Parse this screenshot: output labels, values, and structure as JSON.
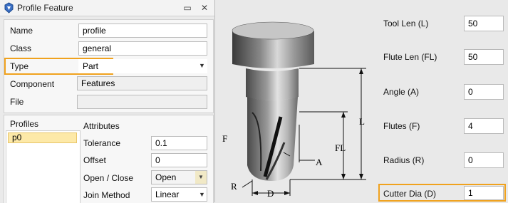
{
  "window": {
    "title": "Profile Feature"
  },
  "properties": {
    "name": {
      "label": "Name",
      "value": "profile"
    },
    "class": {
      "label": "Class",
      "value": "general"
    },
    "type": {
      "label": "Type",
      "value": "Part"
    },
    "component": {
      "label": "Component",
      "value": "Features"
    },
    "file": {
      "label": "File",
      "value": ""
    }
  },
  "profiles": {
    "header": "Profiles",
    "items": [
      "p0"
    ]
  },
  "attributes": {
    "header": "Attributes",
    "tolerance": {
      "label": "Tolerance",
      "value": "0.1"
    },
    "offset": {
      "label": "Offset",
      "value": "0"
    },
    "open_close": {
      "label": "Open / Close",
      "value": "Open"
    },
    "join_method": {
      "label": "Join Method",
      "value": "Linear"
    }
  },
  "tool_params": {
    "tool_len": {
      "label": "Tool Len (L)",
      "value": "50"
    },
    "flute_len": {
      "label": "Flute Len (FL)",
      "value": "50"
    },
    "angle": {
      "label": "Angle (A)",
      "value": "0"
    },
    "flutes": {
      "label": "Flutes (F)",
      "value": "4"
    },
    "radius": {
      "label": "Radius (R)",
      "value": "0"
    },
    "cutter_dia": {
      "label": "Cutter Dia (D)",
      "value": "1"
    }
  },
  "diagram_labels": {
    "l": "L",
    "fl": "FL",
    "a": "A",
    "f": "F",
    "r": "R",
    "d": "D"
  },
  "colors": {
    "highlight": "#f0a21e",
    "selected_row": "#fde9a8"
  }
}
